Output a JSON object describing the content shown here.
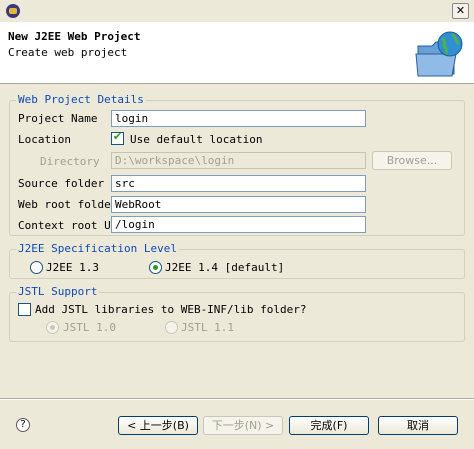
{
  "window": {
    "close_glyph": "✕"
  },
  "header": {
    "title": "New J2EE Web Project",
    "subtitle": "Create web project",
    "graphic": "globe-folder-icon"
  },
  "details": {
    "group_title": "Web Project Details",
    "project_name_label": "Project Name",
    "project_name_value": "login",
    "location_label": "Location",
    "use_default_label": "Use default location",
    "use_default_checked": true,
    "directory_label": "Directory",
    "directory_value": "D:\\workspace\\login",
    "browse_label": "Browse...",
    "source_folder_label": "Source folder",
    "source_folder_value": "src",
    "web_root_label": "Web root folder",
    "web_root_value": "WebRoot",
    "context_root_label": "Context root URL",
    "context_root_value": "/login"
  },
  "spec": {
    "group_title": "J2EE Specification Level",
    "option_13": "J2EE 1.3",
    "option_14": "J2EE 1.4 [default]",
    "selected": "J2EE 1.4 [default]"
  },
  "jstl": {
    "group_title": "JSTL Support",
    "add_label": "Add JSTL libraries to WEB-INF/lib folder?",
    "add_checked": false,
    "option_10": "JSTL 1.0",
    "option_11": "JSTL 1.1",
    "selected": "JSTL 1.0"
  },
  "footer": {
    "help_glyph": "?",
    "back_label": "< 上一步(B)",
    "next_label": "下一步(N) >",
    "finish_label": "完成(F)",
    "cancel_label": "取消"
  },
  "colors": {
    "group_title": "#1048b8",
    "dialog_bg": "#ece9d8",
    "check_green": "#21a121"
  }
}
